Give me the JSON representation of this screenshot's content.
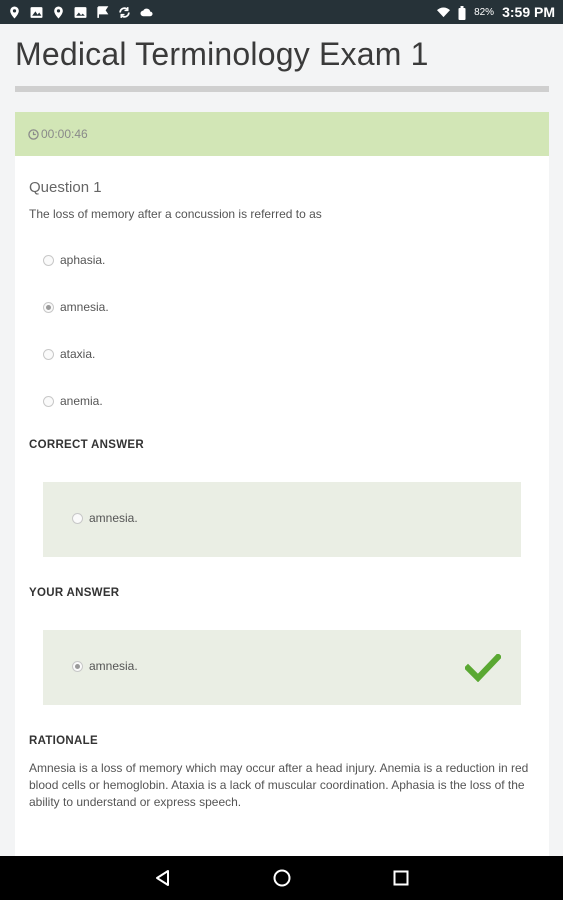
{
  "status_bar": {
    "battery_percent": "82%",
    "time": "3:59 PM",
    "left_icons": [
      "location-pin-icon",
      "image-icon",
      "location-pin-icon",
      "photo-icon",
      "flag-icon",
      "sync-icon",
      "cloud-icon"
    ],
    "right_icons": [
      "wifi-icon",
      "battery-icon"
    ]
  },
  "header": {
    "title": "Medical Terminology Exam 1"
  },
  "timer": {
    "value": "00:00:46",
    "bar_color": "#d2e6b6"
  },
  "question": {
    "heading": "Question 1",
    "text": "The loss of memory after a concussion is referred to as",
    "options": [
      {
        "label": "aphasia.",
        "selected": false
      },
      {
        "label": "amnesia.",
        "selected": true
      },
      {
        "label": "ataxia.",
        "selected": false
      },
      {
        "label": "anemia.",
        "selected": false
      }
    ]
  },
  "correct_answer": {
    "heading": "CORRECT ANSWER",
    "value": "amnesia."
  },
  "your_answer": {
    "heading": "YOUR ANSWER",
    "value": "amnesia.",
    "correct": true,
    "check_color": "#5aa832"
  },
  "rationale": {
    "heading": "RATIONALE",
    "text": "Amnesia is a loss of memory which may occur after a head injury.   Anemia is a reduction in red blood cells or hemoglobin. Ataxia is a lack of muscular coordination. Aphasia is the loss of the ability to understand or express speech."
  },
  "nav_bar": {
    "buttons": [
      "back-icon",
      "home-icon",
      "recents-icon"
    ]
  }
}
